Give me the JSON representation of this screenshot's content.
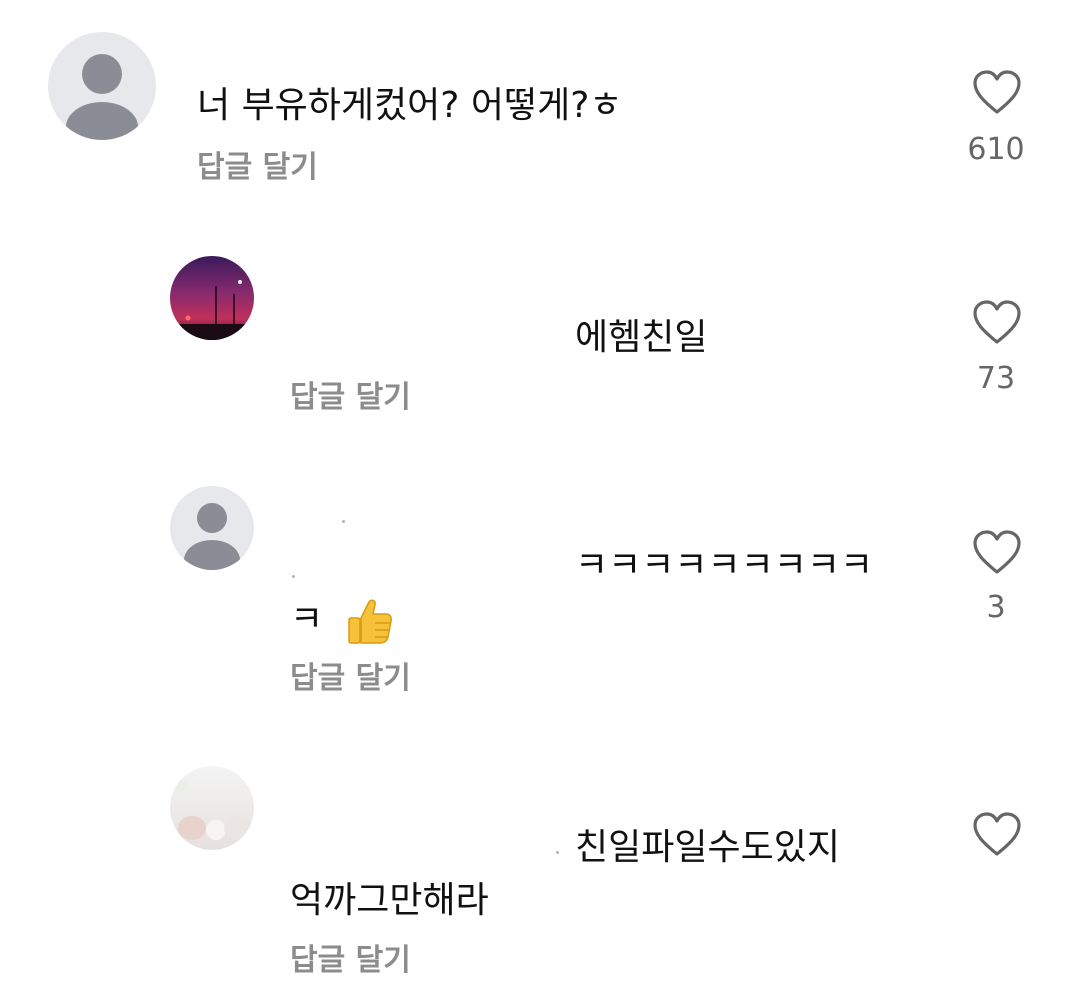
{
  "comments": [
    {
      "text": "너 부유하게컸어? 어떻게?ㅎ",
      "reply_label": "답글 달기",
      "likes": "610",
      "avatar": "default-user-icon"
    },
    {
      "text": "에헴친일",
      "reply_label": "답글 달기",
      "likes": "73",
      "avatar": "sunset-photo"
    },
    {
      "text_line1": "ㅋㅋㅋㅋㅋㅋㅋㅋㅋ",
      "text_line2": "ㅋ",
      "emoji": "thumbs-up-icon",
      "reply_label": "답글 달기",
      "likes": "3",
      "avatar": "default-user-icon"
    },
    {
      "text_line1": "친일파일수도있지",
      "text_line2": "억까그만해라",
      "reply_label": "답글 달기",
      "likes": "",
      "avatar": "blurred-photo"
    }
  ],
  "colors": {
    "text": "#111111",
    "reply": "#8c8c8c",
    "count": "#666666",
    "heart_stroke": "#666666",
    "avatar_bg": "#e7e8ec",
    "avatar_fg": "#8a8d96"
  }
}
